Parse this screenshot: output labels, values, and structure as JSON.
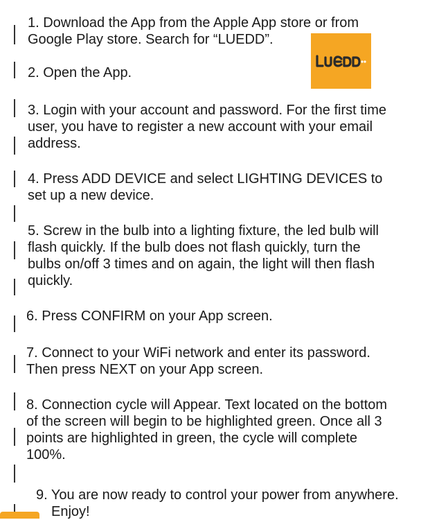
{
  "steps": [
    {
      "lines": [
        "1. Download the App from the Apple App store or from",
        "Google Play store. Search for “LUEDD”."
      ]
    },
    {
      "lines": [
        "2. Open the App."
      ]
    },
    {
      "lines": [
        "3. Login with your account and password. For the first time",
        "user, you have to register a new account with your email",
        "address."
      ]
    },
    {
      "lines": [
        "4. Press ADD DEVICE and select LIGHTING DEVICES to",
        "set up a new device."
      ]
    },
    {
      "lines": [
        "5. Screw in the bulb into a lighting fixture, the led bulb will",
        "flash quickly. If the bulb does not flash quickly, turn the",
        "bulbs on/off 3 times and on again, the light will then flash",
        "quickly."
      ]
    },
    {
      "lines": [
        "6. Press CONFIRM on your App screen."
      ]
    },
    {
      "lines": [
        "7. Connect to your WiFi network and enter its password.",
        "Then press NEXT on your App screen."
      ]
    },
    {
      "lines": [
        "8. Connection cycle will Appear. Text located on the bottom",
        "of the screen will begin to be highlighted green. Once all 3",
        "points are highlighted in green, the cycle will complete",
        "100%."
      ]
    },
    {
      "lines": [
        "9. You are now ready to control your power from anywhere.",
        "Enjoy!"
      ]
    }
  ],
  "logo": {
    "text": "LUEDD",
    "background": "#f5a623",
    "foreground": "#2b2b2b"
  },
  "colors": {
    "text": "#1a1a1a",
    "accent": "#f5a623"
  }
}
